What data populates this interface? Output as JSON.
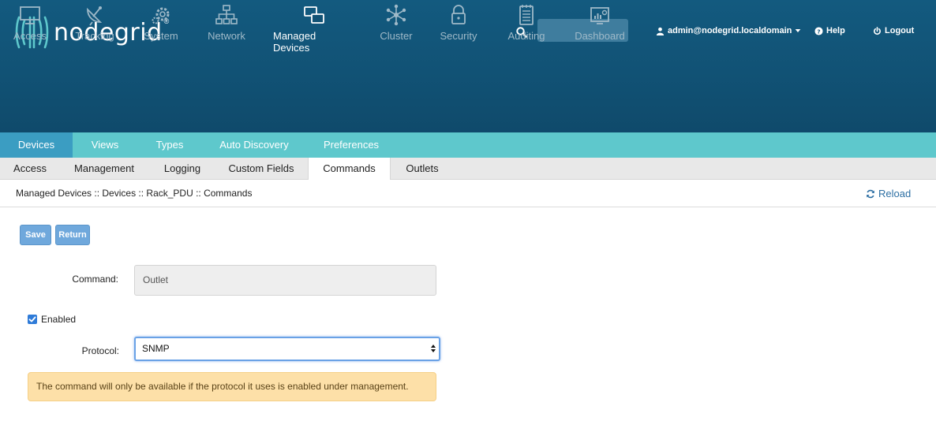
{
  "brand": {
    "name": "nodegrid",
    "reg": "®"
  },
  "topbar": {
    "search_value": "",
    "user": "admin@nodegrid.localdomain",
    "help": "Help",
    "logout": "Logout"
  },
  "nav": [
    {
      "label": "Access",
      "icon": "monitor-icon"
    },
    {
      "label": "Tracking",
      "icon": "satellite-dish-icon"
    },
    {
      "label": "System",
      "icon": "gears-icon"
    },
    {
      "label": "Network",
      "icon": "network-icon"
    },
    {
      "label": "Managed Devices",
      "icon": "devices-icon"
    },
    {
      "label": "Cluster",
      "icon": "cluster-icon"
    },
    {
      "label": "Security",
      "icon": "lock-icon"
    },
    {
      "label": "Auditing",
      "icon": "notepad-icon"
    },
    {
      "label": "Dashboard",
      "icon": "dashboard-icon"
    }
  ],
  "tabs_primary": [
    "Devices",
    "Views",
    "Types",
    "Auto Discovery",
    "Preferences"
  ],
  "tabs_secondary": [
    "Access",
    "Management",
    "Logging",
    "Custom Fields",
    "Commands",
    "Outlets"
  ],
  "breadcrumb": "Managed Devices :: Devices :: Rack_PDU :: Commands",
  "reload": "Reload",
  "buttons": {
    "save": "Save",
    "return": "Return"
  },
  "form": {
    "command_label": "Command:",
    "command_value": "Outlet",
    "enabled_label": "Enabled",
    "enabled": true,
    "protocol_label": "Protocol:",
    "protocol_value": "SNMP"
  },
  "alert": "The command will only be available if the protocol it uses is enabled under management.",
  "colors": {
    "header": "#135a7f",
    "tabs_primary": "#5ec8cc",
    "tab_active": "#3b9dc2",
    "button": "#6fa8dc",
    "alert": "#fde0a8"
  }
}
